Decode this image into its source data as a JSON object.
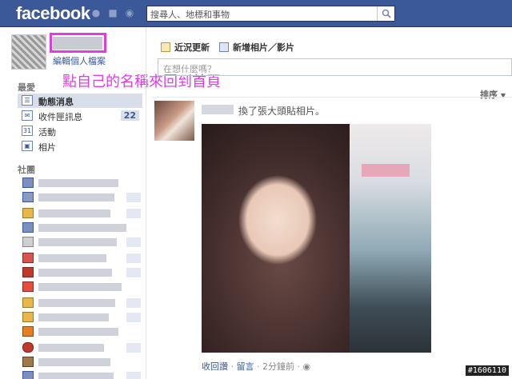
{
  "header": {
    "logo": "facebook",
    "search_placeholder": "搜尋人、地標和事物"
  },
  "profile": {
    "edit_link": "編輯個人檔案",
    "annotation": "點自己的名稱來回到首頁"
  },
  "sidebar": {
    "favorites_title": "最愛",
    "items": [
      {
        "label": "動態消息",
        "icon": "news-feed-icon",
        "active": true
      },
      {
        "label": "收件匣訊息",
        "icon": "inbox-icon",
        "badge": "22"
      },
      {
        "label": "活動",
        "icon": "calendar-icon"
      },
      {
        "label": "相片",
        "icon": "photos-icon"
      }
    ],
    "groups_title": "社團"
  },
  "composer": {
    "tab_status": "近況更新",
    "tab_photo": "新增相片／影片",
    "placeholder": "在想什麼嗎？"
  },
  "feed": {
    "sort_label": "排序",
    "story_text": "換了張大頭貼相片。",
    "meta_like": "收回讚",
    "meta_comment": "留言",
    "meta_time": "2分鐘前",
    "meta_sep": " · "
  },
  "watermark": "#1606110",
  "colors": {
    "brand_blue": "#3b5998",
    "annotation_magenta": "#e23be6"
  }
}
